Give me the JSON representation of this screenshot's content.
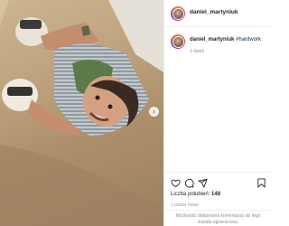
{
  "post": {
    "username": "daniel_martyniuk",
    "caption": {
      "username": "daniel_martyniuk",
      "hashtag": "#hardwork",
      "time_ago": "1 dzień"
    },
    "actions": {
      "like_icon": "heart-icon",
      "comment_icon": "comment-icon",
      "share_icon": "send-icon",
      "save_icon": "bookmark-icon"
    },
    "likes_label": "Liczba polubień:",
    "likes_count": "148",
    "post_time": "1 DZIEŃ TEMU",
    "comments_disabled_line1": "Możliwość dodawania komentarzy do tego",
    "comments_disabled_line2": "została ograniczona."
  },
  "colors": {
    "text": "#262626",
    "muted": "#8e8e8e",
    "hashtag": "#00376b",
    "border": "#efefef"
  }
}
